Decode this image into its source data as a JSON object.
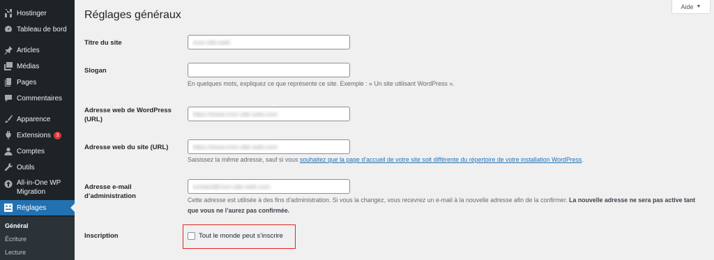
{
  "sidebar": {
    "items": [
      {
        "label": "Hostinger",
        "icon": "hostinger-icon"
      },
      {
        "label": "Tableau de bord",
        "icon": "dashboard-icon"
      },
      {
        "label": "Articles",
        "icon": "pin-icon"
      },
      {
        "label": "Médias",
        "icon": "media-icon"
      },
      {
        "label": "Pages",
        "icon": "page-icon"
      },
      {
        "label": "Commentaires",
        "icon": "comment-icon"
      },
      {
        "label": "Apparence",
        "icon": "brush-icon"
      },
      {
        "label": "Extensions",
        "icon": "plugin-icon",
        "badge": "3"
      },
      {
        "label": "Comptes",
        "icon": "user-icon"
      },
      {
        "label": "Outils",
        "icon": "wrench-icon"
      },
      {
        "label": "All-in-One WP Migration",
        "icon": "migration-icon"
      },
      {
        "label": "Réglages",
        "icon": "settings-icon",
        "active": true
      }
    ],
    "submenu": [
      {
        "label": "Général",
        "current": true
      },
      {
        "label": "Écriture"
      },
      {
        "label": "Lecture"
      }
    ]
  },
  "help_button": {
    "label": "Aide",
    "caret": "▼"
  },
  "page_title": "Réglages généraux",
  "fields": {
    "site_title": {
      "label": "Titre du site",
      "value": "mon-site-web"
    },
    "tagline": {
      "label": "Slogan",
      "value": "",
      "description": "En quelques mots, expliquez ce que représente ce site. Exemple : « Un site utilisant WordPress »."
    },
    "wp_address": {
      "label": "Adresse web de WordPress (URL)",
      "value": "https://www.mon-site-web.com"
    },
    "site_address": {
      "label": "Adresse web du site (URL)",
      "value": "https://www.mon-site-web.com",
      "description_before": "Saisissez la même adresse, sauf si vous ",
      "description_link": "souhaitez que la page d’accueil de votre site soit différente du répertoire de votre installation WordPress",
      "description_after": "."
    },
    "admin_email": {
      "label": "Adresse e-mail d’administration",
      "value": "contact@mon-site-web.com",
      "description": "Cette adresse est utilisée à des fins d’administration. Si vous la changez, vous recevrez un e-mail à la nouvelle adresse afin de la confirmer. ",
      "description_bold": "La nouvelle adresse ne sera pas active tant que vous ne l’aurez pas confirmée."
    },
    "membership": {
      "label": "Inscription",
      "checkbox_label": "Tout le monde peut s’inscrire",
      "checked": false
    }
  },
  "colors": {
    "sidebar_bg": "#1d2327",
    "active_bg": "#2271b1",
    "badge": "#d63638",
    "link": "#2271b1",
    "highlight": "#e02424"
  }
}
